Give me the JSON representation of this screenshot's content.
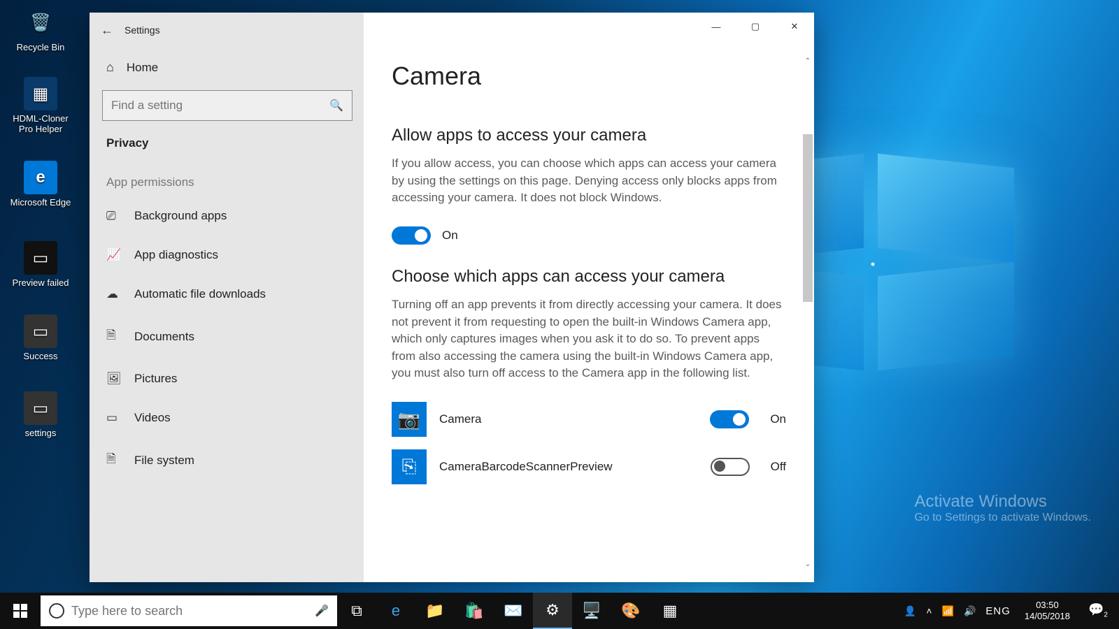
{
  "desktop": {
    "icons": [
      {
        "label": "Recycle Bin"
      },
      {
        "label": "HDML-Cloner Pro Helper"
      },
      {
        "label": "Microsoft Edge"
      },
      {
        "label": "Preview failed"
      },
      {
        "label": "Success"
      },
      {
        "label": "settings"
      }
    ],
    "activate_title": "Activate Windows",
    "activate_sub": "Go to Settings to activate Windows."
  },
  "window": {
    "title": "Settings",
    "home": "Home",
    "search_placeholder": "Find a setting",
    "category": "Privacy",
    "group": "App permissions",
    "nav": [
      {
        "icon": "⎚",
        "label": "Background apps"
      },
      {
        "icon": "📈",
        "label": "App diagnostics"
      },
      {
        "icon": "☁",
        "label": "Automatic file downloads"
      },
      {
        "icon": "🗎",
        "label": "Documents"
      },
      {
        "icon": "🖼",
        "label": "Pictures"
      },
      {
        "icon": "▭",
        "label": "Videos"
      },
      {
        "icon": "🗎",
        "label": "File system"
      }
    ]
  },
  "page": {
    "heading": "Camera",
    "section1_title": "Allow apps to access your camera",
    "section1_body": "If you allow access, you can choose which apps can access your camera by using the settings on this page. Denying access only blocks apps from accessing your camera. It does not block Windows.",
    "master_toggle": {
      "state": "on",
      "label": "On"
    },
    "section2_title": "Choose which apps can access your camera",
    "section2_body": "Turning off an app prevents it from directly accessing your camera. It does not prevent it from requesting to open the built-in Windows Camera app, which only captures images when you ask it to do so. To prevent apps from also accessing the camera using the built-in Windows Camera app, you must also turn off access to the Camera app in the following list.",
    "apps": [
      {
        "name": "Camera",
        "state": "on",
        "label": "On",
        "glyph": "📷"
      },
      {
        "name": "CameraBarcodeScannerPreview",
        "state": "off",
        "label": "Off",
        "glyph": "⎘"
      }
    ]
  },
  "taskbar": {
    "search_placeholder": "Type here to search",
    "lang": "ENG",
    "time": "03:50",
    "date": "14/05/2018",
    "notif_count": "2"
  }
}
